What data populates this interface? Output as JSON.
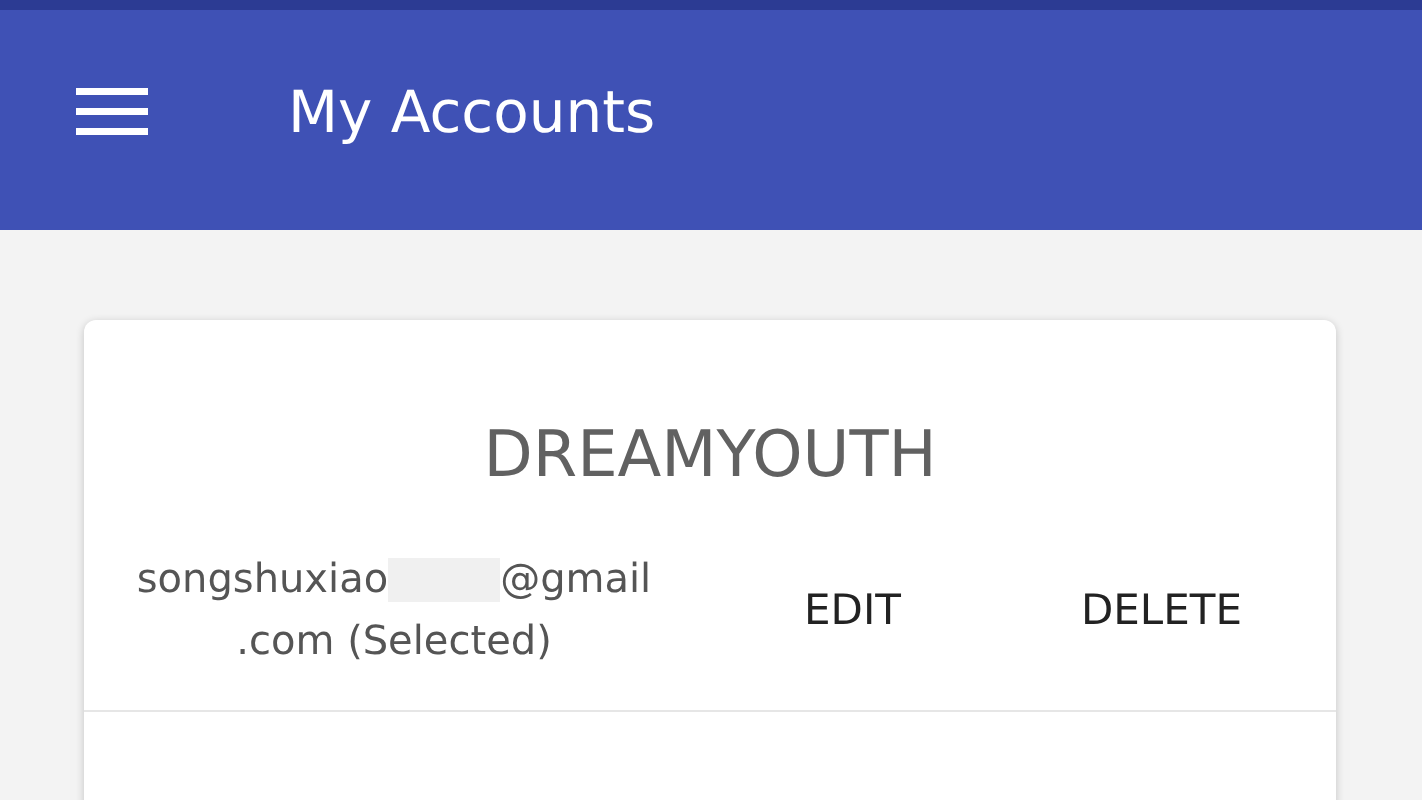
{
  "app_bar": {
    "title": "My Accounts"
  },
  "accounts": [
    {
      "name": "DREAMYOUTH",
      "email_start": "songshuxiao",
      "email_redacted": true,
      "email_end": "@gmail",
      "email_tail": ".com",
      "status": "(Selected)",
      "actions": [
        "EDIT",
        "DELETE"
      ]
    }
  ]
}
